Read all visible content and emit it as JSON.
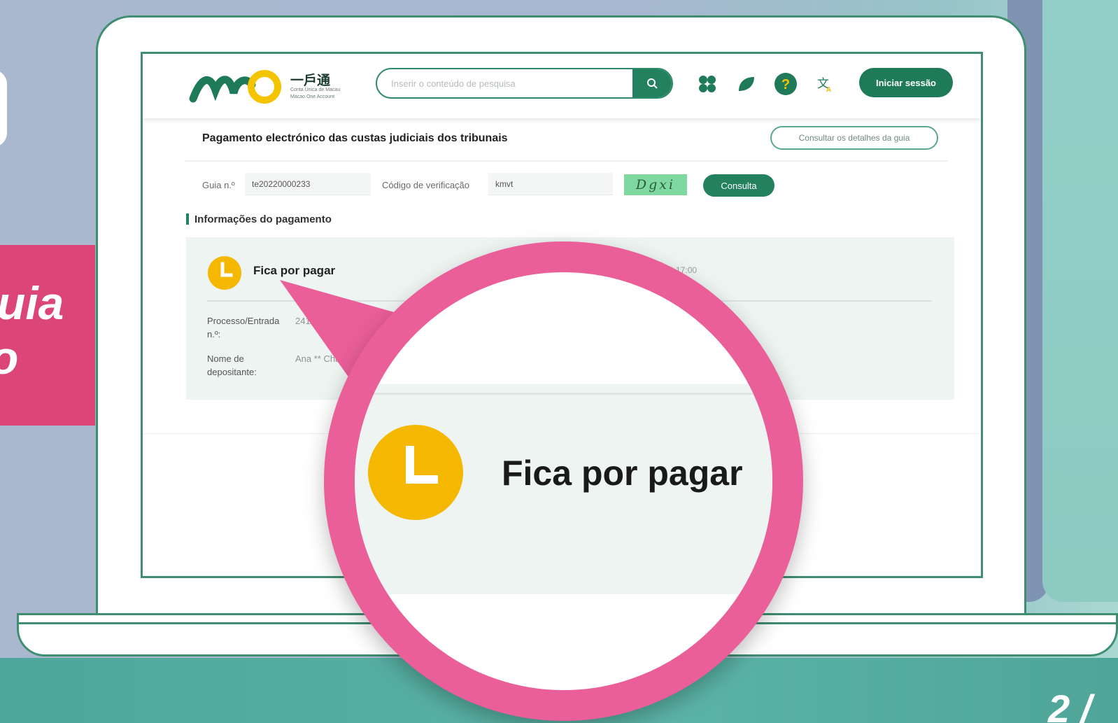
{
  "banner": {
    "fragment_top": "uia",
    "fragment_bottom": "o",
    "corner_number": "2 /"
  },
  "header": {
    "logo_text_cn": "一戶通",
    "logo_sub_line1": "Conta Única de Macau",
    "logo_sub_line2": "Macao One Account",
    "search_placeholder": "Inserir o conteúdo de pesquisa",
    "login_label": "Iniciar sessão",
    "icons": [
      "apps-icon",
      "leaf-icon",
      "help-icon",
      "translate-icon",
      "search-icon"
    ]
  },
  "page": {
    "title": "Pagamento electrónico das custas judiciais dos tribunais",
    "details_button": "Consultar os detalhes da guia"
  },
  "form": {
    "guia_label": "Guia n.º",
    "guia_value": "te20220000233",
    "code_label": "Código de verificação",
    "code_value": "kmvt",
    "captcha_text": "Dgxi",
    "consulta_label": "Consulta"
  },
  "payment": {
    "section_title": "Informações do pagamento",
    "status": "Fica por pagar",
    "time_fragment": "9 17:00",
    "process_label": "Processo/Entrada n.º:",
    "process_value": "241/",
    "depositor_label": "Nome de depositante:",
    "depositor_value": "Ana ** Chan"
  },
  "magnifier": {
    "status": "Fica por pagar"
  },
  "colors": {
    "brand_green": "#23815f",
    "status_yellow": "#f5b800",
    "callout_pink": "#ea5e99",
    "banner_pink": "#dc4578"
  }
}
